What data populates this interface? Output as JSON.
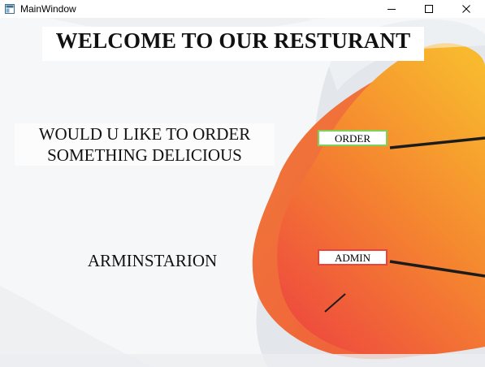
{
  "window": {
    "title": "MainWindow"
  },
  "main": {
    "heading": "WELCOME TO OUR RESTURANT",
    "order_prompt_line1": "WOULD U LIKE TO ORDER",
    "order_prompt_line2": "SOMETHING DELICIOUS",
    "order_button": "ORDER",
    "admin_label": "ARMINSTARION",
    "admin_button": "ADMIN"
  },
  "colors": {
    "order_border": "#7dd35a",
    "admin_border": "#e8443a",
    "blob_orange": "#f5a623",
    "blob_red": "#ee4f3c"
  }
}
